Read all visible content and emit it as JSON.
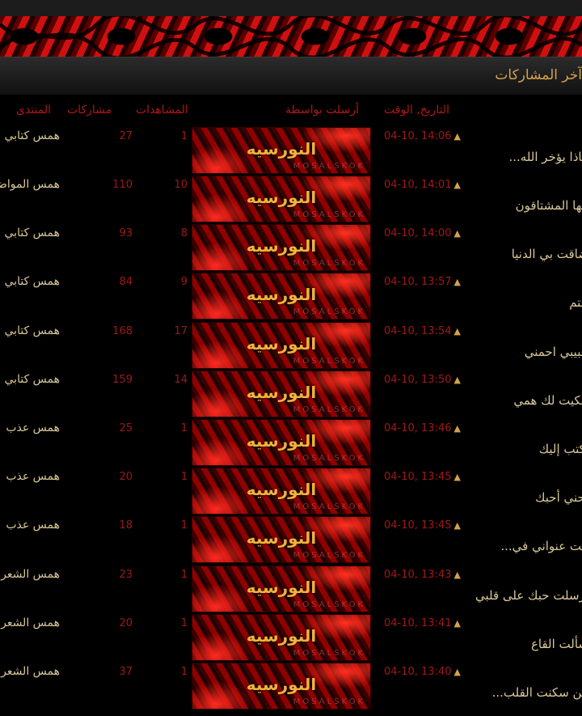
{
  "section": {
    "title": "آخر المشاركات"
  },
  "columns": {
    "posted_by": "أرسلت بواسطة",
    "date_time": "التاريخ, الوقت",
    "replies": "مشاركات",
    "views": "المشاهدات",
    "forum": "المنتدى"
  },
  "avatar_watermark": "MOSALSKOK",
  "rows": [
    {
      "title": "ماذا يؤخر الله...",
      "date": "04-10, 14:06",
      "author": "النورسيه",
      "replies": "1",
      "views": "27",
      "forum": "همس كتابي"
    },
    {
      "title": "أيها المشتاقون",
      "date": "04-10, 14:01",
      "author": "النورسيه",
      "replies": "10",
      "views": "110",
      "forum": "همس المواضيع"
    },
    {
      "title": "ضاقت بي الدنيا",
      "date": "04-10, 14:00",
      "author": "النورسيه",
      "replies": "8",
      "views": "93",
      "forum": "همس كتابي"
    },
    {
      "title": "ختم",
      "date": "04-10, 13:57",
      "author": "النورسيه",
      "replies": "9",
      "views": "84",
      "forum": "همس كتابي"
    },
    {
      "title": "حبيبي احمني",
      "date": "04-10, 13:54",
      "author": "النورسيه",
      "replies": "17",
      "views": "168",
      "forum": "همس كتابي"
    },
    {
      "title": "حكيت لك همي",
      "date": "04-10, 13:50",
      "author": "النورسيه",
      "replies": "14",
      "views": "159",
      "forum": "همس كتابي"
    },
    {
      "title": "أكتب إليك",
      "date": "04-10, 13:46",
      "author": "النورسيه",
      "replies": "1",
      "views": "25",
      "forum": "همس عذب"
    },
    {
      "title": "أحني أحبك",
      "date": "04-10, 13:45",
      "author": "النورسيه",
      "replies": "1",
      "views": "20",
      "forum": "همس عذب"
    },
    {
      "title": "أنت عنواني في...",
      "date": "04-10, 13:45",
      "author": "النورسيه",
      "replies": "1",
      "views": "18",
      "forum": "همس عذب"
    },
    {
      "title": "أرسلت حبك على قلبي",
      "date": "04-10, 13:43",
      "author": "النورسيه",
      "replies": "1",
      "views": "23",
      "forum": "همس الشعر"
    },
    {
      "title": "سألت القاع",
      "date": "04-10, 13:41",
      "author": "النورسيه",
      "replies": "1",
      "views": "20",
      "forum": "همس الشعر"
    },
    {
      "title": "من سكنت القلب...",
      "date": "04-10, 13:40",
      "author": "النورسيه",
      "replies": "1",
      "views": "37",
      "forum": "همس الشعر"
    }
  ]
}
